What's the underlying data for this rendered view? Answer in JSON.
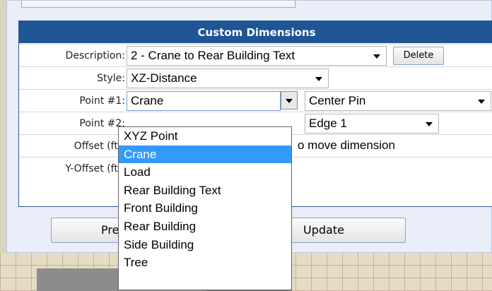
{
  "panel": {
    "header": "Custom Dimensions",
    "description": {
      "label": "Description:",
      "value": "2 - Crane to Rear Building Text",
      "delete_label": "Delete"
    },
    "style": {
      "label": "Style:",
      "value": "XZ-Distance"
    },
    "point1": {
      "label": "Point #1:",
      "value": "Crane",
      "secondary_value": "Center Pin"
    },
    "point2": {
      "label": "Point #2:",
      "secondary_value": "Edge 1"
    },
    "offset": {
      "label": "Offset (ft):",
      "hint": "o move dimension"
    },
    "y_offset": {
      "label": "Y-Offset (ft):"
    }
  },
  "dropdown": {
    "options": [
      "XYZ Point",
      "Crane",
      "Load",
      "Rear Building Text",
      "Front Building",
      "Rear Building",
      "Side Building",
      "Tree"
    ],
    "selected": "Crane"
  },
  "buttons": {
    "previous_label": "Previ",
    "update_label": "Update"
  },
  "colors": {
    "header_bg": "#1f5495",
    "selected_option_bg": "#3399ff",
    "panel_bg": "#e9eef8"
  }
}
